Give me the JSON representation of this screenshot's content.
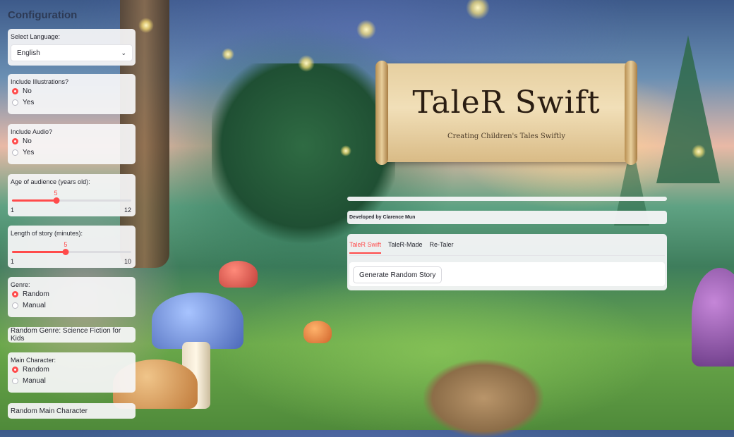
{
  "sidebar": {
    "title": "Configuration",
    "language": {
      "label": "Select Language:",
      "value": "English"
    },
    "illustrations": {
      "label": "Include Illustrations?",
      "options": [
        "No",
        "Yes"
      ],
      "selected": "No"
    },
    "audio": {
      "label": "Include Audio?",
      "options": [
        "No",
        "Yes"
      ],
      "selected": "No"
    },
    "age": {
      "label": "Age of audience (years old):",
      "value": "5",
      "min": "1",
      "max": "12"
    },
    "length": {
      "label": "Length of story (minutes):",
      "value": "5",
      "min": "1",
      "max": "10"
    },
    "genre": {
      "label": "Genre:",
      "options": [
        "Random",
        "Manual"
      ],
      "selected": "Random"
    },
    "random_genre": "Random Genre: Science Fiction for Kids",
    "main_character": {
      "label": "Main Character:",
      "options": [
        "Random",
        "Manual"
      ],
      "selected": "Random"
    },
    "random_main_character": "Random Main Character"
  },
  "main": {
    "banner_title": "TaleR Swift",
    "banner_subtitle": "Creating Children's Tales Swiftly",
    "developer": "Developed by Clarence Mun",
    "tabs": [
      {
        "label": "TaleR Swift",
        "active": true
      },
      {
        "label": "TaleR-Made",
        "active": false
      },
      {
        "label": "Re-Taler",
        "active": false
      }
    ],
    "generate_button": "Generate Random Story"
  },
  "colors": {
    "accent": "#ff4b4b",
    "card_bg": "#f6f6f8",
    "text": "#262730"
  },
  "icons": {
    "select_chevron": "chevron-down-icon"
  }
}
